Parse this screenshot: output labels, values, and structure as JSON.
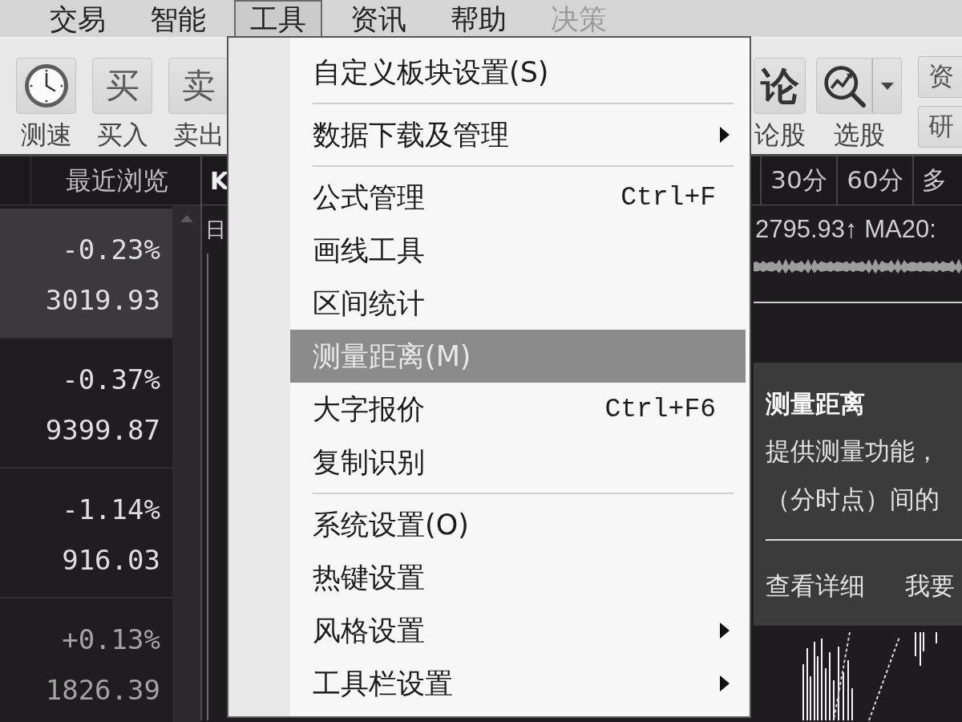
{
  "menubar": {
    "items": [
      {
        "label": "交易",
        "selected": false,
        "disabled": false
      },
      {
        "label": "智能",
        "selected": false,
        "disabled": false
      },
      {
        "label": "工具",
        "selected": true,
        "disabled": false
      },
      {
        "label": "资讯",
        "selected": false,
        "disabled": false
      },
      {
        "label": "帮助",
        "selected": false,
        "disabled": false
      },
      {
        "label": "决策",
        "selected": false,
        "disabled": true
      }
    ]
  },
  "toolbar": {
    "left_buttons": [
      {
        "kind": "clock",
        "label": "测速"
      },
      {
        "kind": "glyph",
        "glyph": "买",
        "label": "买入"
      },
      {
        "kind": "glyph",
        "glyph": "卖",
        "label": "卖出"
      }
    ],
    "right_buttons": [
      {
        "kind": "glyph",
        "glyph": "论",
        "label": "论股"
      },
      {
        "kind": "finder",
        "label": "选股"
      }
    ],
    "small_buttons": [
      "资",
      "研"
    ]
  },
  "recent_panel": {
    "header": "最近浏览",
    "rows": [
      {
        "change": "-0.23%",
        "price": "3019.93",
        "selected": true,
        "rising": false
      },
      {
        "change": "-0.37%",
        "price": "9399.87",
        "selected": false,
        "rising": false
      },
      {
        "change": "-1.14%",
        "price": "916.03",
        "selected": false,
        "rising": false
      },
      {
        "change": "+0.13%",
        "price": "1826.39",
        "selected": false,
        "rising": true
      }
    ]
  },
  "chart": {
    "title": "K",
    "period_tabs": [
      {
        "label": "30分",
        "selected": false
      },
      {
        "label": "60分",
        "selected": false
      },
      {
        "label": "多",
        "selected": false
      }
    ],
    "sub_label": "日",
    "indicator": "2795.93↑ MA20:"
  },
  "tools_menu": {
    "groups": [
      {
        "items": [
          {
            "label": "自定义板块设置(S)",
            "submenu": false,
            "selected": false
          }
        ]
      },
      {
        "items": [
          {
            "label": "数据下载及管理",
            "submenu": true,
            "selected": false
          }
        ]
      },
      {
        "items": [
          {
            "label": "公式管理",
            "shortcut": "Ctrl+F",
            "submenu": false,
            "selected": false
          },
          {
            "label": "画线工具",
            "submenu": false,
            "selected": false
          },
          {
            "label": "区间统计",
            "submenu": false,
            "selected": false
          },
          {
            "label": "测量距离(M)",
            "submenu": false,
            "selected": true
          },
          {
            "label": "大字报价",
            "shortcut": "Ctrl+F6",
            "submenu": false,
            "selected": false
          },
          {
            "label": "复制识别",
            "submenu": false,
            "selected": false
          }
        ]
      },
      {
        "items": [
          {
            "label": "系统设置(O)",
            "submenu": false,
            "selected": false
          },
          {
            "label": "热键设置",
            "submenu": false,
            "selected": false
          },
          {
            "label": "风格设置",
            "submenu": true,
            "selected": false
          },
          {
            "label": "工具栏设置",
            "submenu": true,
            "selected": false
          }
        ]
      }
    ]
  },
  "tooltip": {
    "title": "测量距离",
    "lines": [
      "提供测量功能，",
      "（分时点）间的"
    ],
    "links": [
      "查看详细",
      "我要"
    ]
  }
}
